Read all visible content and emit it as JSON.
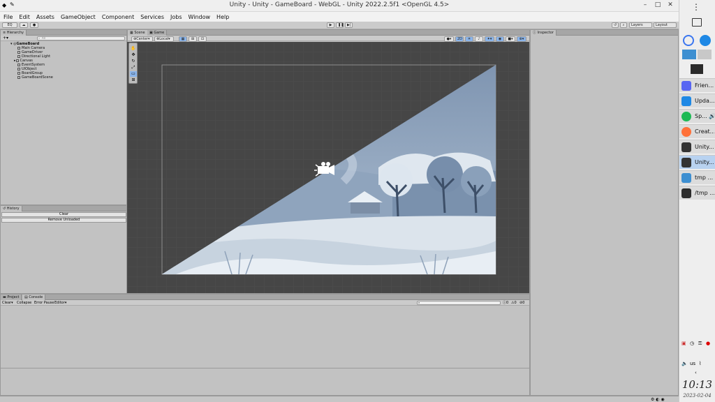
{
  "window": {
    "title": "Unity - Unity - GameBoard - WebGL - Unity 2022.2.5f1 <OpenGL 4.5>",
    "minimize": "–",
    "maximize": "□",
    "close": "✕"
  },
  "menu": [
    "File",
    "Edit",
    "Assets",
    "GameObject",
    "Component",
    "Services",
    "Jobs",
    "Window",
    "Help"
  ],
  "toolbar": {
    "account": "EQ",
    "layers": "Layers",
    "layout": "Layout"
  },
  "hierarchy": {
    "tab": "Hierarchy",
    "search_placeholder": "All",
    "items": [
      {
        "label": "GameBoard",
        "level": 0
      },
      {
        "label": "Main Camera",
        "level": 1
      },
      {
        "label": "GameDriver",
        "level": 1
      },
      {
        "label": "Directional Light",
        "level": 1
      },
      {
        "label": "Canvas",
        "level": 1
      },
      {
        "label": "EventSystem",
        "level": 1
      },
      {
        "label": "UIObject",
        "level": 1
      },
      {
        "label": "BoardGroup",
        "level": 1
      },
      {
        "label": "GameBoardScene",
        "level": 1
      }
    ]
  },
  "history": {
    "tab": "History",
    "clear": "Clear",
    "remove_unloaded": "Remove Unloaded"
  },
  "scene": {
    "tab_scene": "Scene",
    "tab_game": "Game",
    "pivot": "Center",
    "space": "Local"
  },
  "inspector": {
    "tab": "Inspector"
  },
  "console": {
    "tab_project": "Project",
    "tab_console": "Console",
    "clear": "Clear",
    "collapse": "Collapse",
    "error_pause": "Error Pause",
    "editor": "Editor",
    "count_log": "0",
    "count_warn": "0",
    "count_err": "0"
  },
  "taskbar": {
    "tasks": [
      {
        "label": "Frien...",
        "color": "#5865f2"
      },
      {
        "label": "Upda...",
        "color": "#1e88e5"
      },
      {
        "label": "Sp...",
        "color": "#1db954"
      },
      {
        "label": "Creat...",
        "color": "#ff7139"
      },
      {
        "label": "Unity...",
        "color": "#333333"
      },
      {
        "label": "Unity...",
        "color": "#333333"
      },
      {
        "label": "tmp ...",
        "color": "#3d8fd1"
      },
      {
        "label": "/tmp ...",
        "color": "#2b2b2b"
      }
    ],
    "keyboard": "us",
    "time": "10:13",
    "date": "2023-02-04"
  }
}
